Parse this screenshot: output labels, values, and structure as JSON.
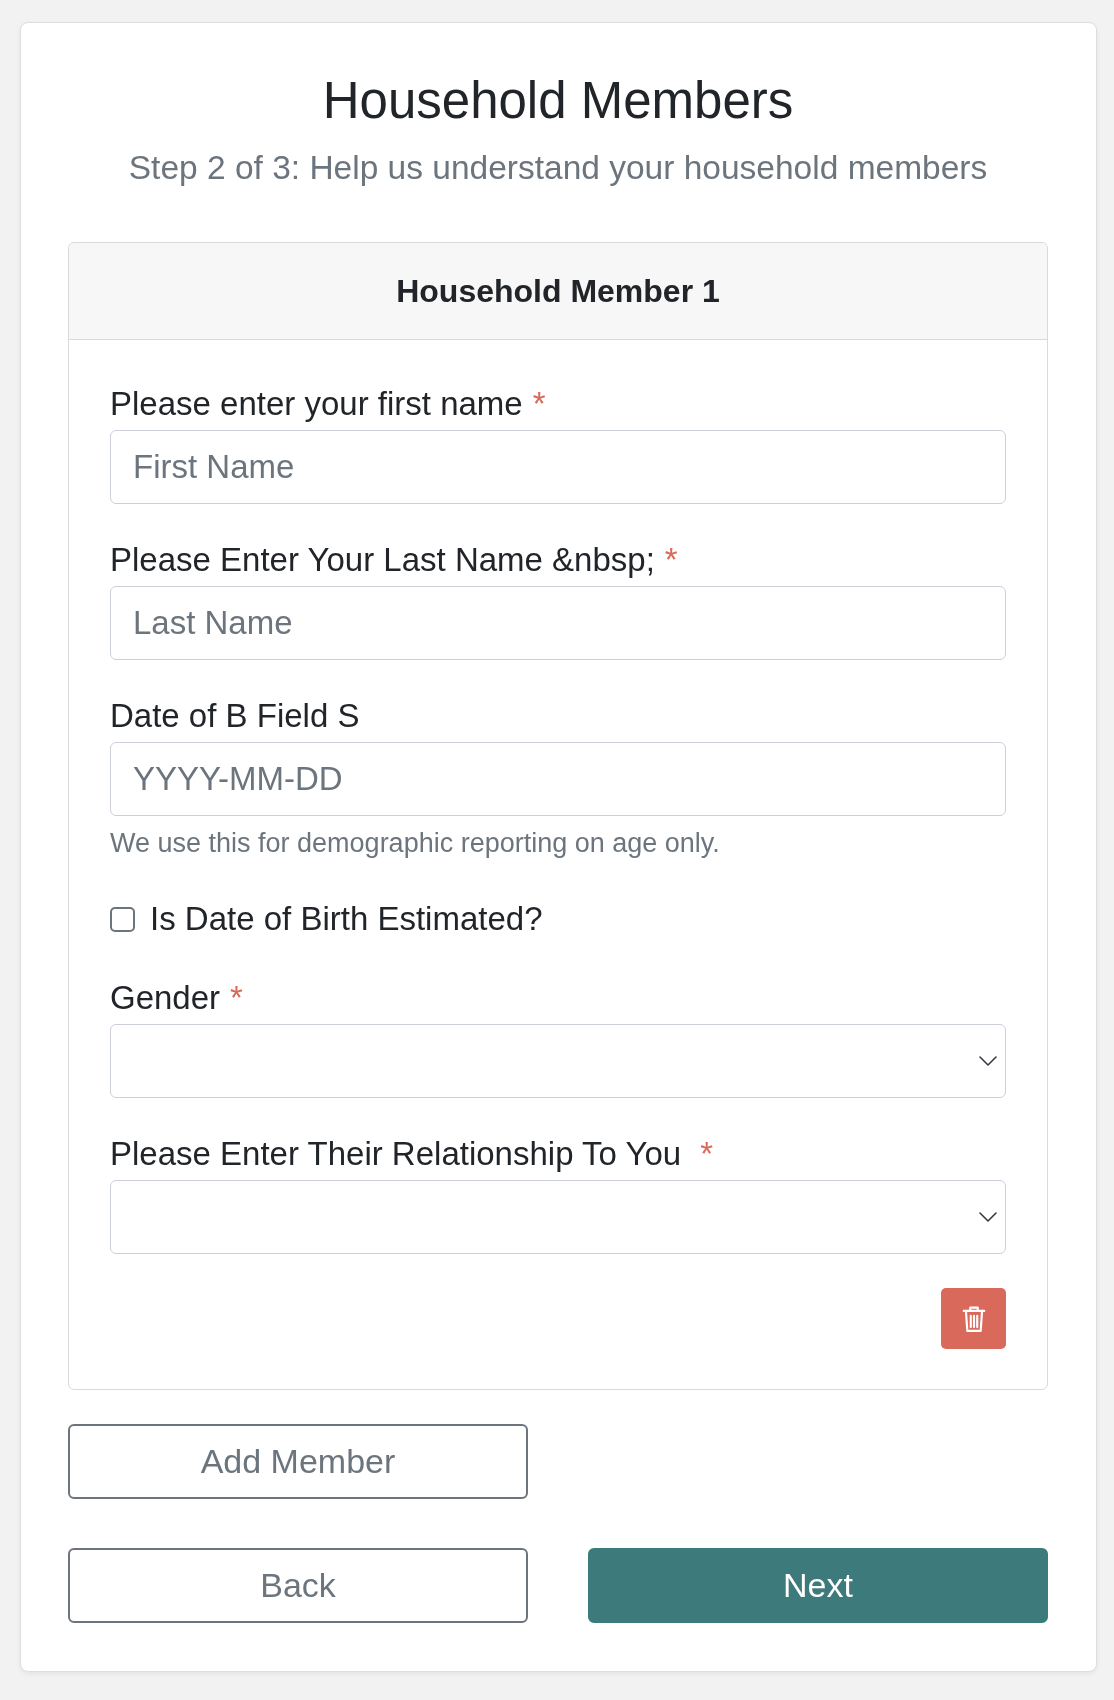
{
  "page": {
    "title": "Household Members",
    "subtitle": "Step 2 of 3: Help us understand your household members"
  },
  "member_card": {
    "title": "Household Member 1",
    "fields": [
      {
        "kind": "text",
        "label": "Please enter your first name",
        "required_mark": "*",
        "placeholder": "First Name"
      },
      {
        "kind": "text",
        "label": "Please Enter Your Last Name &nbsp;",
        "required_mark": "*",
        "placeholder": "Last Name"
      },
      {
        "kind": "text",
        "label": "Date of B Field S",
        "placeholder": "YYYY-MM-DD",
        "help": "We use this for demographic reporting on age only."
      },
      {
        "kind": "checkbox",
        "label": "Is Date of Birth Estimated?",
        "checked": false
      },
      {
        "kind": "select",
        "label": "Gender",
        "required_mark": "*"
      },
      {
        "kind": "select",
        "label": "Please Enter Their Relationship To You ",
        "required_mark": "*"
      }
    ]
  },
  "add_button": {
    "label": "Add Member"
  },
  "nav_buttons": [
    {
      "label": "Back",
      "kind": "secondary"
    },
    {
      "label": "Next",
      "kind": "primary"
    }
  ]
}
